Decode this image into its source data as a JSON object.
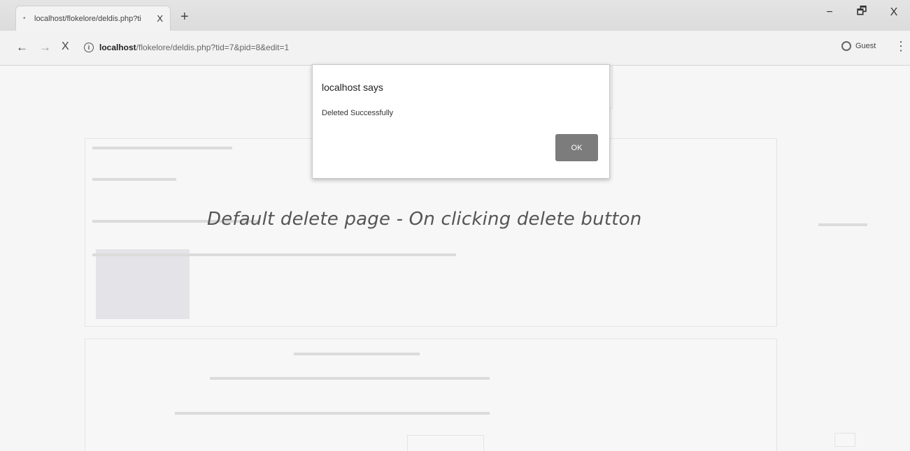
{
  "browser": {
    "tab": {
      "title": "localhost/flokelore/deldis.php?ti",
      "close_glyph": "X"
    },
    "new_tab_glyph": "+",
    "window_controls": {
      "minimize": "−",
      "restore": "🗗",
      "close": "X"
    },
    "nav": {
      "back": "←",
      "forward": "→",
      "stop": "X"
    },
    "url": {
      "host": "localhost",
      "rest": "/flokelore/deldis.php?tid=7&pid=8&edit=1"
    },
    "info_glyph": "i",
    "guest_label": "Guest",
    "menu_glyph": "⋮"
  },
  "alert": {
    "title": "localhost says",
    "message": "Deleted Successfully",
    "ok_label": "OK"
  },
  "caption": "Default delete page - On clicking delete button",
  "icons": [
    "info-icon",
    "guest-icon",
    "back-arrow-icon",
    "forward-arrow-icon",
    "stop-icon",
    "menu-icon"
  ]
}
